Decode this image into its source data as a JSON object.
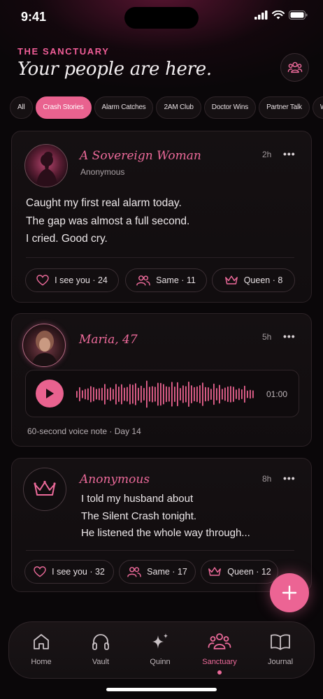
{
  "status": {
    "time": "9:41"
  },
  "header": {
    "eyebrow": "THE SANCTUARY",
    "title": "Your people are here."
  },
  "chips": [
    "All",
    "Crash Stories",
    "Alarm Catches",
    "2AM Club",
    "Doctor Wins",
    "Partner Talk",
    "Wins & Shifts"
  ],
  "active_chip": "Crash Stories",
  "posts": [
    {
      "name": "A Sovereign Woman",
      "sub": "Anonymous",
      "time": "2h",
      "lines": [
        "Caught my first real alarm today.",
        "The gap was almost a full second.",
        "I cried. Good cry."
      ],
      "reactions": [
        "I see you · 24",
        "Same · 11",
        "Queen · 8"
      ]
    },
    {
      "name": "Maria, 47",
      "time": "5h",
      "duration": "01:00",
      "caption": "60-second voice note · Day 14"
    },
    {
      "name": "Anonymous",
      "time": "8h",
      "lines": [
        "I told my husband about",
        "The Silent Crash tonight.",
        "He listened the whole way through..."
      ],
      "reactions": [
        "I see you · 32",
        "Same · 17",
        "Queen · 12"
      ]
    }
  ],
  "more_glyph": "•••",
  "tabs": [
    {
      "label": "Home",
      "icon": "home-icon"
    },
    {
      "label": "Vault",
      "icon": "headphones-icon"
    },
    {
      "label": "Quinn",
      "icon": "sparkle-icon"
    },
    {
      "label": "Sanctuary",
      "icon": "people-icon"
    },
    {
      "label": "Journal",
      "icon": "book-icon"
    }
  ],
  "active_tab": "Sanctuary",
  "colors": {
    "accent": "#ec6a9a",
    "background": "#0a0709",
    "card": "#151012"
  }
}
